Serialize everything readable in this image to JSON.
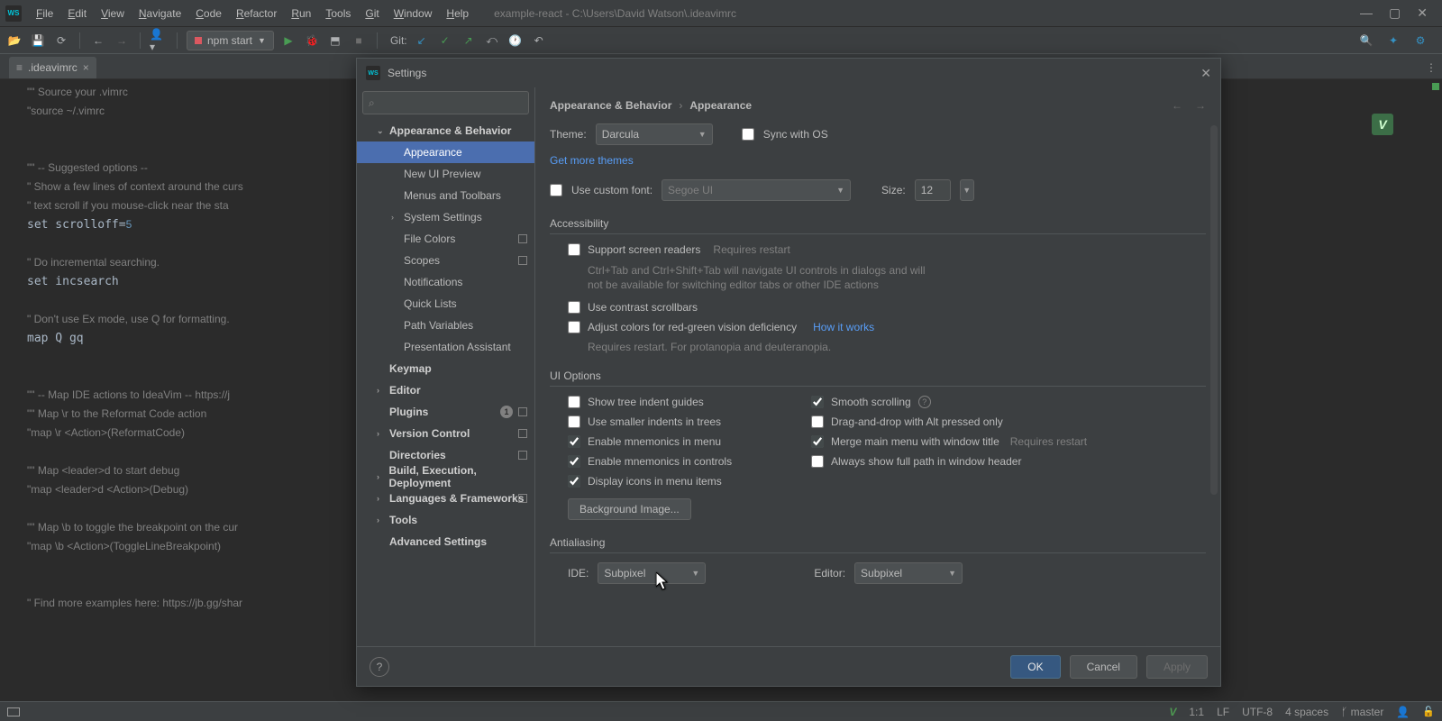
{
  "window": {
    "title": "example-react - C:\\Users\\David Watson\\.ideavimrc",
    "menus": [
      "File",
      "Edit",
      "View",
      "Navigate",
      "Code",
      "Refactor",
      "Run",
      "Tools",
      "Git",
      "Window",
      "Help"
    ]
  },
  "toolbar": {
    "run_config": "npm start",
    "git_label": "Git:"
  },
  "tabs": {
    "active": ".ideavimrc"
  },
  "editor": {
    "lines": [
      {
        "t": "c",
        "s": "\"\" Source your .vimrc"
      },
      {
        "t": "c",
        "s": "\"source ~/.vimrc"
      },
      {
        "t": "b",
        "s": ""
      },
      {
        "t": "b",
        "s": ""
      },
      {
        "t": "c",
        "s": "\"\" -- Suggested options --"
      },
      {
        "t": "c",
        "s": "\" Show a few lines of context around the curs"
      },
      {
        "t": "c",
        "s": "\" text scroll if you mouse-click near the sta"
      },
      {
        "t": "s",
        "pre": "set scrolloff=",
        "num": "5"
      },
      {
        "t": "b",
        "s": ""
      },
      {
        "t": "c",
        "s": "\" Do incremental searching."
      },
      {
        "t": "p",
        "s": "set incsearch"
      },
      {
        "t": "b",
        "s": ""
      },
      {
        "t": "c",
        "s": "\" Don't use Ex mode, use Q for formatting."
      },
      {
        "t": "p",
        "s": "map Q gq"
      },
      {
        "t": "b",
        "s": ""
      },
      {
        "t": "b",
        "s": ""
      },
      {
        "t": "c",
        "s": "\"\" -- Map IDE actions to IdeaVim -- https://j"
      },
      {
        "t": "c",
        "s": "\"\" Map \\r to the Reformat Code action"
      },
      {
        "t": "c",
        "s": "\"map \\r <Action>(ReformatCode)"
      },
      {
        "t": "b",
        "s": ""
      },
      {
        "t": "c",
        "s": "\"\" Map <leader>d to start debug"
      },
      {
        "t": "c",
        "s": "\"map <leader>d <Action>(Debug)"
      },
      {
        "t": "b",
        "s": ""
      },
      {
        "t": "c",
        "s": "\"\" Map \\b to toggle the breakpoint on the cur"
      },
      {
        "t": "c",
        "s": "\"map \\b <Action>(ToggleLineBreakpoint)"
      },
      {
        "t": "b",
        "s": ""
      },
      {
        "t": "b",
        "s": ""
      },
      {
        "t": "c",
        "s": "\" Find more examples here: https://jb.gg/shar"
      }
    ]
  },
  "dialog": {
    "title": "Settings",
    "search_icon": "⌕",
    "crumb1": "Appearance & Behavior",
    "crumb2": "Appearance",
    "tree": [
      {
        "label": "Appearance & Behavior",
        "level": 1,
        "arrow": "v"
      },
      {
        "label": "Appearance",
        "level": 2,
        "selected": true
      },
      {
        "label": "New UI Preview",
        "level": 2
      },
      {
        "label": "Menus and Toolbars",
        "level": 2
      },
      {
        "label": "System Settings",
        "level": 2,
        "arrow": ">"
      },
      {
        "label": "File Colors",
        "level": 2,
        "sq": true
      },
      {
        "label": "Scopes",
        "level": 2,
        "sq": true
      },
      {
        "label": "Notifications",
        "level": 2
      },
      {
        "label": "Quick Lists",
        "level": 2
      },
      {
        "label": "Path Variables",
        "level": 2
      },
      {
        "label": "Presentation Assistant",
        "level": 2
      },
      {
        "label": "Keymap",
        "level": 1
      },
      {
        "label": "Editor",
        "level": 1,
        "arrow": ">"
      },
      {
        "label": "Plugins",
        "level": 1,
        "num": "1",
        "sq": true
      },
      {
        "label": "Version Control",
        "level": 1,
        "arrow": ">",
        "sq": true
      },
      {
        "label": "Directories",
        "level": 1,
        "sq": true
      },
      {
        "label": "Build, Execution, Deployment",
        "level": 1,
        "arrow": ">"
      },
      {
        "label": "Languages & Frameworks",
        "level": 1,
        "arrow": ">",
        "sq": true
      },
      {
        "label": "Tools",
        "level": 1,
        "arrow": ">"
      },
      {
        "label": "Advanced Settings",
        "level": 1
      }
    ],
    "panel": {
      "theme_label": "Theme:",
      "theme_value": "Darcula",
      "sync_os": "Sync with OS",
      "get_more_themes": "Get more themes",
      "use_custom_font": "Use custom font:",
      "font_value": "Segoe UI",
      "size_label": "Size:",
      "size_value": "12",
      "accessibility": "Accessibility",
      "support_screen_readers": "Support screen readers",
      "requires_restart": "Requires restart",
      "sr_hint": "Ctrl+Tab and Ctrl+Shift+Tab will navigate UI controls in dialogs and will not be available for switching editor tabs or other IDE actions",
      "contrast_scrollbars": "Use contrast scrollbars",
      "adjust_colors": "Adjust colors for red-green vision deficiency",
      "how_it_works": "How it works",
      "adjust_hint": "Requires restart. For protanopia and deuteranopia.",
      "ui_options": "UI Options",
      "tree_indent": "Show tree indent guides",
      "smaller_indents": "Use smaller indents in trees",
      "mnemonics_menu": "Enable mnemonics in menu",
      "mnemonics_controls": "Enable mnemonics in controls",
      "display_icons": "Display icons in menu items",
      "smooth_scrolling": "Smooth scrolling",
      "drag_drop_alt": "Drag-and-drop with Alt pressed only",
      "merge_menu": "Merge main menu with window title",
      "always_full_path": "Always show full path in window header",
      "background_image": "Background Image...",
      "antialiasing": "Antialiasing",
      "ide_label": "IDE:",
      "ide_value": "Subpixel",
      "editor_label": "Editor:",
      "editor_value": "Subpixel"
    },
    "footer": {
      "ok": "OK",
      "cancel": "Cancel",
      "apply": "Apply"
    }
  },
  "statusbar": {
    "pos": "1:1",
    "le": "LF",
    "enc": "UTF-8",
    "indent": "4 spaces",
    "branch": "master"
  }
}
